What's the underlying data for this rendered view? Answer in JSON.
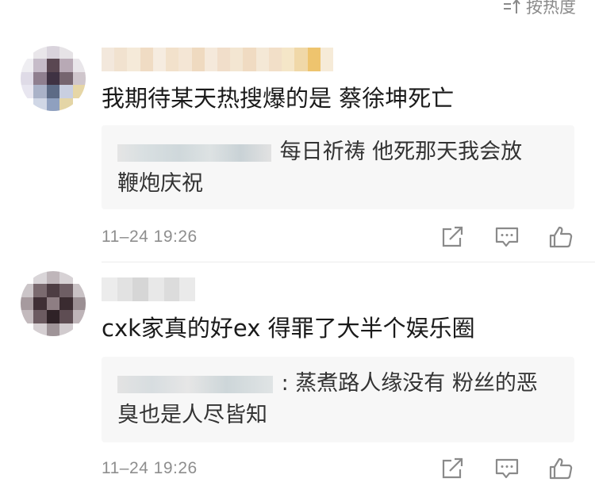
{
  "sort": {
    "label": "按热度",
    "icon": "sort-icon"
  },
  "comments": [
    {
      "text": "我期待某天热搜爆的是  蔡徐坤死亡",
      "reply": {
        "text_line1": "每日祈祷  他死那天我会放",
        "text_line2": "鞭炮庆祝"
      },
      "timestamp": "11–24 19:26"
    },
    {
      "text": "cxk家真的好ex 得罪了大半个娱乐圈",
      "reply": {
        "text_line1": ": 蒸煮路人缘没有  粉丝的恶",
        "text_line2": "臭也是人尽皆知"
      },
      "timestamp": "11–24 19:26"
    }
  ],
  "icons": {
    "share": "share-icon",
    "reply": "comment-icon",
    "like": "like-icon"
  },
  "colors": {
    "meta_text": "#8e8e8e",
    "reply_bg": "#f7f7f7",
    "icon_stroke": "#8a8a8a"
  }
}
